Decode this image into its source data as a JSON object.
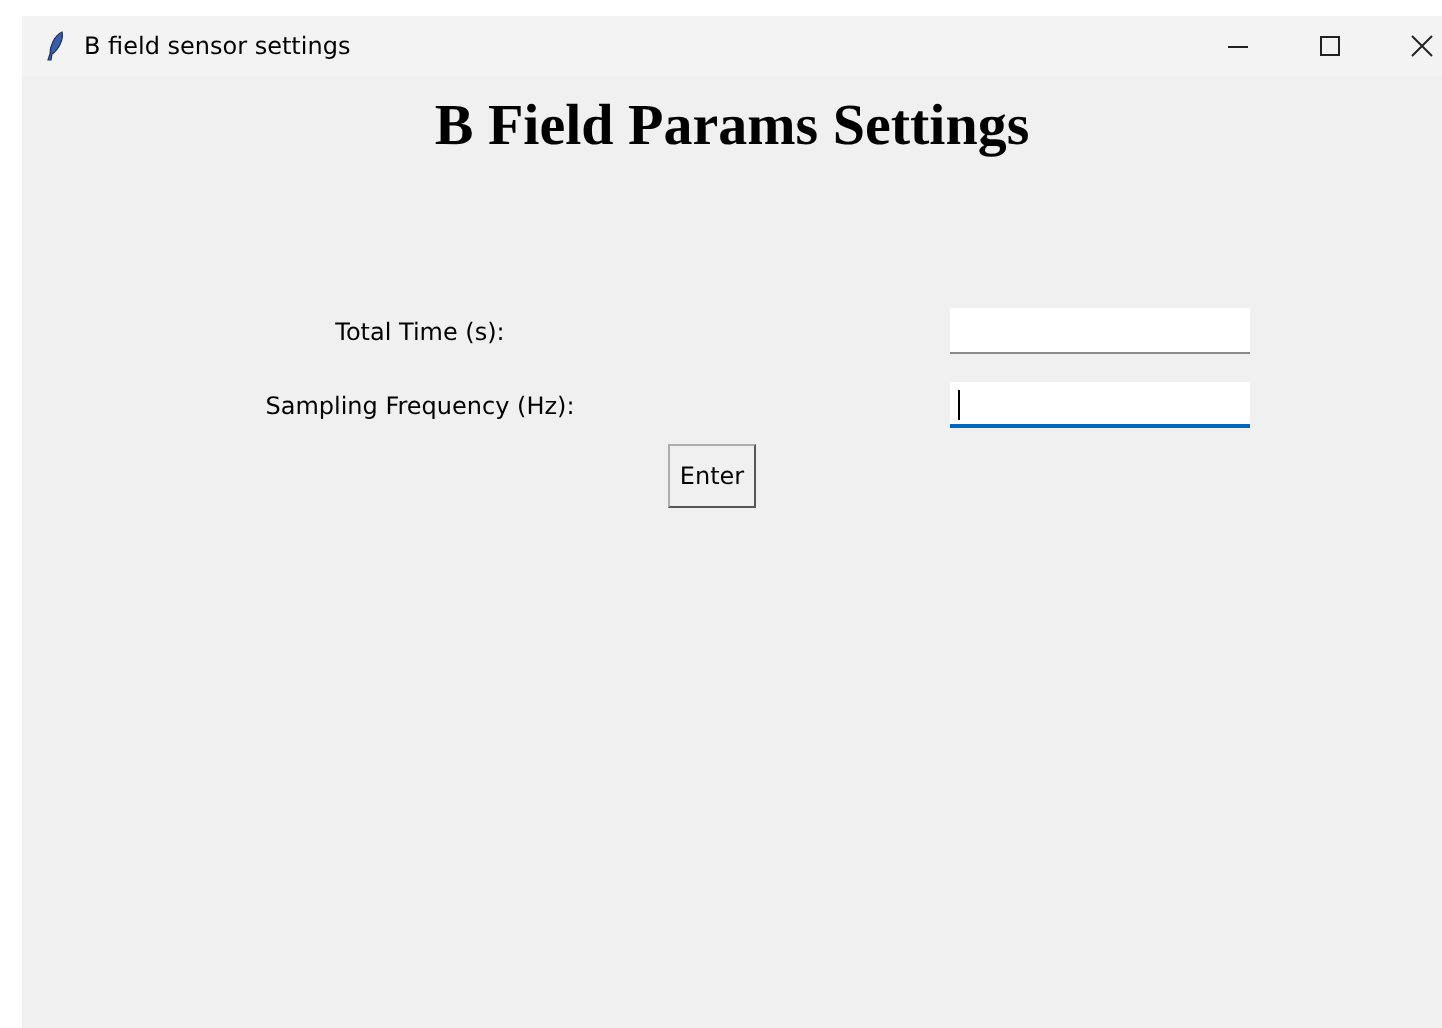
{
  "window": {
    "title": "B field sensor settings"
  },
  "heading": "B Field Params Settings",
  "fields": [
    {
      "label": "Total Time (s):",
      "focused": false
    },
    {
      "label": "Sampling Frequency (Hz):",
      "focused": true
    }
  ],
  "buttons": [
    "Enter"
  ]
}
